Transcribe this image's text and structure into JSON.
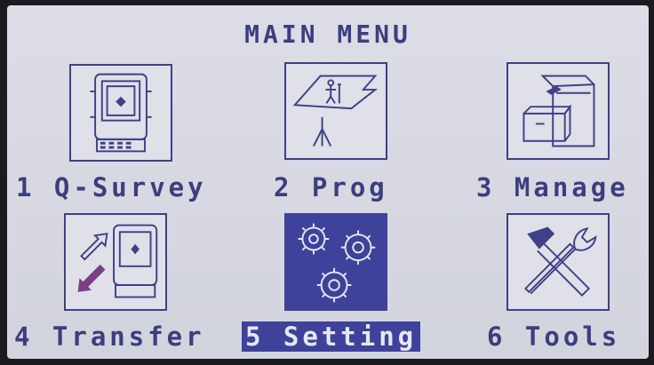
{
  "screen": {
    "title": "MAIN MENU"
  },
  "menu": [
    {
      "label": "1 Q-Survey",
      "icon": "total-station-icon",
      "selected": false
    },
    {
      "label": "2 Prog",
      "icon": "survey-plane-icon",
      "selected": false
    },
    {
      "label": "3 Manage",
      "icon": "file-cabinet-icon",
      "selected": false
    },
    {
      "label": "4 Transfer",
      "icon": "transfer-icon",
      "selected": false
    },
    {
      "label": "5 Setting",
      "icon": "gears-icon",
      "selected": true
    },
    {
      "label": "6 Tools",
      "icon": "tools-icon",
      "selected": false
    }
  ],
  "colors": {
    "lcd_background": "#dcdde6",
    "foreground": "#3b3e7e",
    "selection": "#3f429a"
  }
}
